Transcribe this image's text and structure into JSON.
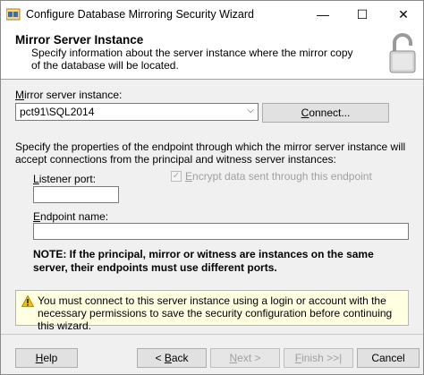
{
  "window": {
    "title": "Configure Database Mirroring Security Wizard",
    "minimize": "—",
    "maximize": "☐",
    "close": "✕"
  },
  "header": {
    "title": "Mirror Server Instance",
    "description": "Specify information about the server instance where the mirror copy of the database will be located."
  },
  "mirror": {
    "label_u": "M",
    "label_rest": "irror server instance:",
    "value": "pct91\\SQL2014",
    "connect_u": "C",
    "connect_rest": "onnect..."
  },
  "endpoint": {
    "instructions": "Specify the properties of the endpoint through which the mirror server instance will accept connections from the principal and witness server instances:",
    "listener_u": "L",
    "listener_rest": "istener port:",
    "listener_value": "",
    "encrypt_u": "E",
    "encrypt_rest": "ncrypt data sent through this endpoint",
    "encrypt_checked": "✓",
    "name_label_u": "E",
    "name_label_rest": "ndpoint name:",
    "name_value": ""
  },
  "note": "NOTE: If the principal, mirror or witness are instances on the same server, their endpoints must use different ports.",
  "warning": "You must connect to this server instance using a login or account with the necessary permissions to save the security configuration before continuing this wizard.",
  "buttons": {
    "help_u": "H",
    "help_rest": "elp",
    "back_prefix": "< ",
    "back_u": "B",
    "back_rest": "ack",
    "next_u": "N",
    "next_rest": "ext >",
    "finish_u": "F",
    "finish_rest": "inish >>|",
    "cancel": "Cancel"
  },
  "colors": {
    "warning_bg": "#ffffe1",
    "disabled_text": "#a0a0a0"
  }
}
